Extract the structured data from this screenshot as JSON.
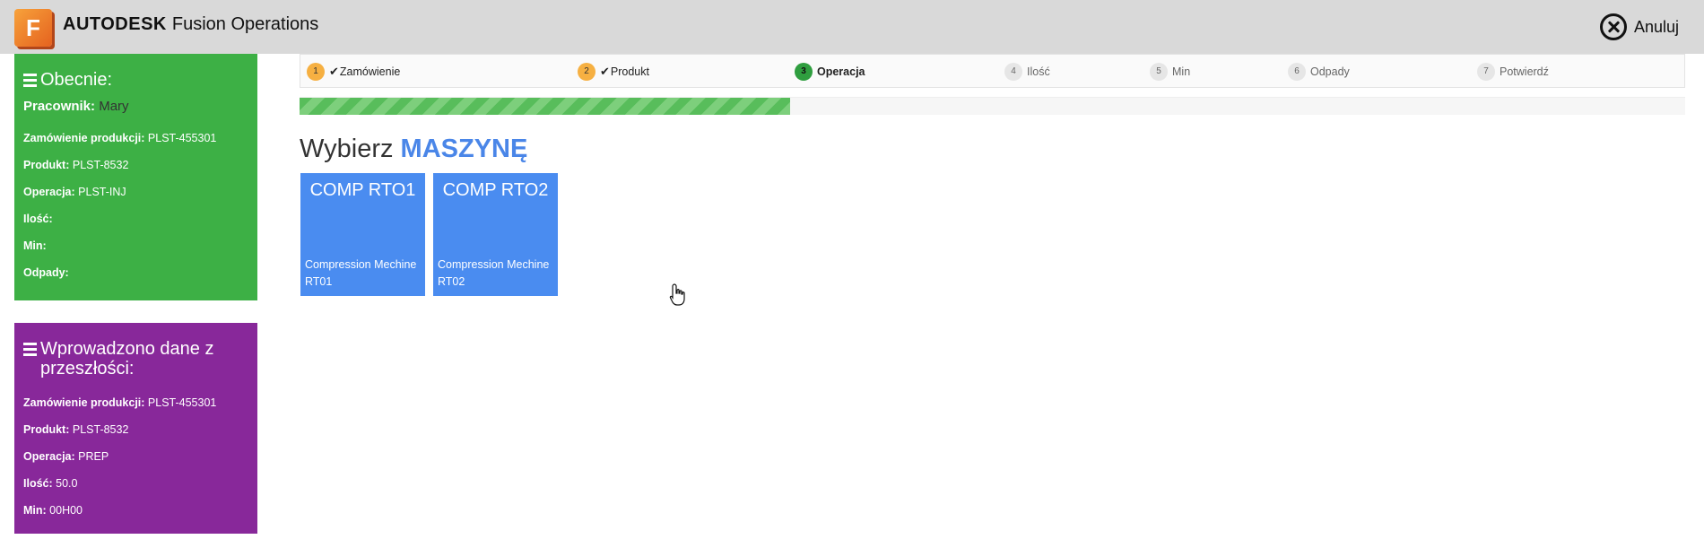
{
  "header": {
    "brand_bold": "AUTODESK",
    "brand_rest": "Fusion Operations",
    "logo_letter": "F",
    "cancel_label": "Anuluj"
  },
  "current": {
    "title": "Obecnie:",
    "worker_label": "Pracownik:",
    "worker_value": "Mary",
    "rows": [
      {
        "label": "Zamówienie produkcji:",
        "value": "PLST-455301"
      },
      {
        "label": "Produkt:",
        "value": "PLST-8532"
      },
      {
        "label": "Operacja:",
        "value": "PLST-INJ"
      },
      {
        "label": "Ilość:",
        "value": ""
      },
      {
        "label": "Min:",
        "value": ""
      },
      {
        "label": "Odpady:",
        "value": ""
      }
    ]
  },
  "past": {
    "title": "Wprowadzono dane z przeszłości:",
    "rows": [
      {
        "label": "Zamówienie produkcji:",
        "value": "PLST-455301"
      },
      {
        "label": "Produkt:",
        "value": "PLST-8532"
      },
      {
        "label": "Operacja:",
        "value": "PREP"
      },
      {
        "label": "Ilość:",
        "value": "50.0"
      },
      {
        "label": "Min:",
        "value": "00H00"
      }
    ]
  },
  "steps": [
    {
      "num": "1",
      "label": "Zamówienie",
      "state": "done"
    },
    {
      "num": "2",
      "label": "Produkt",
      "state": "done"
    },
    {
      "num": "3",
      "label": "Operacja",
      "state": "active"
    },
    {
      "num": "4",
      "label": "Ilość",
      "state": "pending"
    },
    {
      "num": "5",
      "label": "Min",
      "state": "pending"
    },
    {
      "num": "6",
      "label": "Odpady",
      "state": "pending"
    },
    {
      "num": "7",
      "label": "Potwierdź",
      "state": "pending"
    }
  ],
  "progress_fraction": 0.354,
  "heading": {
    "prefix": "Wybierz",
    "accent": "MASZYNĘ"
  },
  "machines": [
    {
      "name": "COMP RTO1",
      "description": "Compression Mechine RT01"
    },
    {
      "name": "COMP RTO2",
      "description": "Compression Mechine RT02"
    }
  ],
  "colors": {
    "current_panel": "#3db045",
    "past_panel": "#88289a",
    "tile": "#4a8cf0",
    "accent_text": "#4a86e8",
    "step_done": "#f6b042",
    "step_active": "#2f9e3f"
  }
}
